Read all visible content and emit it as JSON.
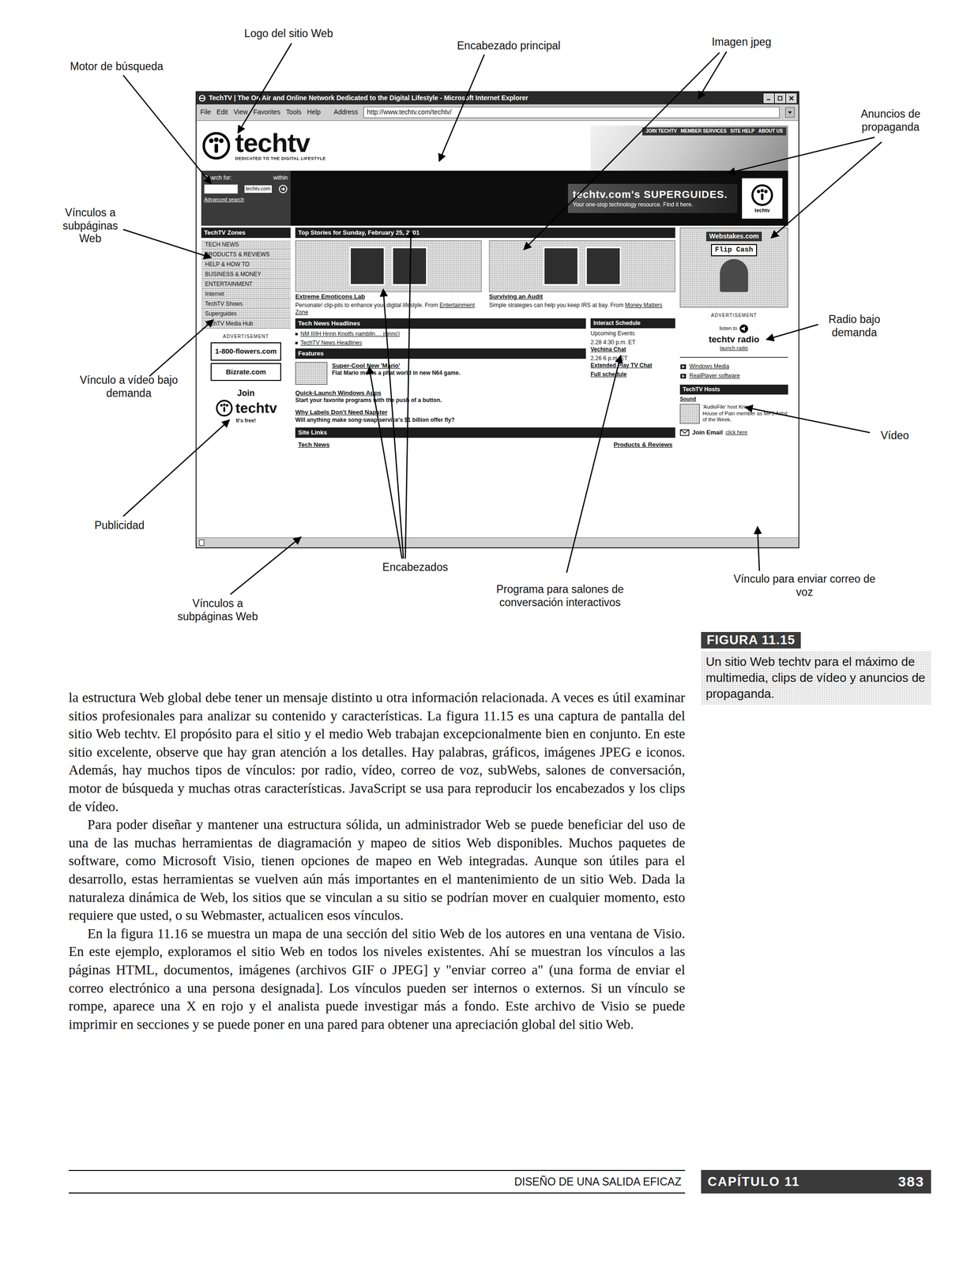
{
  "callouts": [
    {
      "label": "Logo del sitio Web"
    },
    {
      "label": "Encabezado principal"
    },
    {
      "label": "Imagen jpeg"
    },
    {
      "label": "Motor de búsqueda"
    },
    {
      "label": "Anuncios de propaganda"
    },
    {
      "label": "Vínculos a subpáginas Web"
    },
    {
      "label": "Radio bajo demanda"
    },
    {
      "label": "Vínculo a vídeo bajo demanda"
    },
    {
      "label": "Vídeo"
    },
    {
      "label": "Publicidad"
    },
    {
      "label": "Encabezados"
    },
    {
      "label": "Programa para salones de conversación interactivos"
    },
    {
      "label": "Vínculo para enviar correo de voz"
    },
    {
      "label": "Vínculos a subpáginas Web"
    }
  ],
  "browser": {
    "title": "TechTV | The On Air and Online Network Dedicated to the Digital Lifestyle - Microsoft Internet Explorer",
    "menu": [
      "File",
      "Edit",
      "View",
      "Favorites",
      "Tools",
      "Help"
    ],
    "address_label": "Address",
    "address": "http://www.techtv.com/techtv/"
  },
  "site": {
    "logo": "techtv",
    "tagline": "DEDICATED TO THE DIGITAL LIFESTYLE",
    "top_links": [
      "JOIN TECHTV",
      "MEMBER SERVICES",
      "SITE HELP",
      "ABOUT US"
    ],
    "search": {
      "label": "Search for:",
      "within": "within",
      "scope": "techtv.com",
      "advanced": "Advanced search"
    },
    "banner": {
      "title": "techtv.com's SUPERGUIDES.",
      "subtitle": "Your one-stop technology resource. Find it here.",
      "badge": "techtv"
    },
    "zones": {
      "title": "TechTV Zones",
      "items": [
        "TECH NEWS",
        "PRODUCTS & REVIEWS",
        "HELP & HOW TO",
        "BUSINESS & MONEY",
        "ENTERTAINMENT",
        "Internet",
        "TechTV Shows",
        "Superguides",
        "TechTV Media Hub"
      ]
    },
    "ads": {
      "label": "ADVERTISEMENT",
      "items": [
        "1-800-flowers.com",
        "Bizrate.com"
      ]
    },
    "join": {
      "title": "Join",
      "brand": "techtv",
      "sub": "It's free!"
    },
    "top_stories": {
      "title": "Top Stories for Sunday, February 25, 2001",
      "stories": [
        {
          "headline": "Extreme Emoticons Lab",
          "text": "Personate! clip-pils to enhance your digital lifestyle. From",
          "source": "Entertainment Zone"
        },
        {
          "headline": "Surviving an Audit",
          "text": "Simple strategies can help you keep IRS at bay. From",
          "source": "Money Matters"
        }
      ]
    },
    "headlines": {
      "title": "Tech News Headlines",
      "items": [
        "NM IIIIH Hnnn Knotfs namblln.... jsinns'i",
        "TechTV News Headlines"
      ]
    },
    "schedule": {
      "title": "Interact Schedule",
      "subtitle": "Upcoming Events",
      "events": [
        {
          "time": "2.28 4:30 p.m. ET",
          "name": "Vechina Chat"
        },
        {
          "time": "2.26 6 p.m. ET",
          "name": "Extended Play TV Chat"
        }
      ],
      "more": "Full schedule"
    },
    "features": {
      "title": "Features",
      "items": [
        {
          "headline": "Super-Cool New 'Mario'",
          "text": "Flat Mario meets a phat world in new N64 game.",
          "kind": "thumb"
        },
        {
          "headline": "Quick-Launch Windows Apps",
          "text": "Start your favorite programs with the push of a button.",
          "kind": "plain"
        },
        {
          "headline": "Why Labels Don't Need Napster",
          "text": "Will anything make song-swap service's $1 billion offer fly?",
          "kind": "plain"
        }
      ]
    },
    "links_bar": {
      "title": "Site Links",
      "items": [
        "Tech News",
        "Products & Reviews"
      ]
    },
    "right_ad": {
      "brand": "Webstakes.com",
      "button": "Flip Cash",
      "label": "ADVERTISEMENT"
    },
    "radio": {
      "pre": "listen to",
      "title": "techtv radio",
      "link": "launch radio"
    },
    "video": [
      "Windows Media",
      "RealPlayer software"
    ],
    "hosts": {
      "title": "TechTV Hosts",
      "name": "Sound",
      "lines": [
        "'AudioFile' host Kris",
        "House of Pain member as MP3 Artist of the Week."
      ]
    },
    "email": {
      "title": "Join Email",
      "link": "click here"
    }
  },
  "caption": {
    "number": "FIGURA 11.15",
    "text": "Un sitio Web techtv para el máximo de multimedia, clips de vídeo y anuncios de propaganda."
  },
  "body": [
    "la estructura Web global debe tener un mensaje distinto u otra información relacionada. A veces es útil examinar sitios profesionales para analizar su contenido y características. La figura 11.15 es una captura de pantalla del sitio Web techtv. El propósito para el sitio y el medio Web trabajan excepcionalmente bien en conjunto. En este sitio excelente, observe que hay gran atención a los detalles. Hay palabras, gráficos, imágenes JPEG e iconos. Además, hay muchos tipos de vínculos: por radio, vídeo, correo de voz, subWebs, salones de conversación, motor de búsqueda y muchas otras características. JavaScript se usa para reproducir los encabezados y los clips de vídeo.",
    "Para poder diseñar y mantener una estructura sólida, un administrador Web se puede beneficiar del uso de una de las muchas herramientas de diagramación y mapeo de sitios Web disponibles. Muchos paquetes de software, como Microsoft Visio, tienen opciones de mapeo en Web integradas. Aunque son útiles para el desarrollo, estas herramientas se vuelven aún más importantes en el mantenimiento de un sitio Web. Dada la naturaleza dinámica de Web, los sitios que se vinculan a su sitio se podrían mover en cualquier momento, esto requiere que usted, o su Webmaster, actualicen esos vínculos.",
    "En la figura 11.16 se muestra un mapa de una sección del sitio Web de los autores en una ventana de Visio. En este ejemplo, exploramos el sitio Web en todos los niveles existentes. Ahí se muestran los vínculos a las páginas HTML, documentos, imágenes (archivos GIF o JPEG] y \"enviar correo a\" (una forma de enviar el correo electrónico a una persona designada]. Los vínculos pueden ser internos o externos. Si un vínculo se rompe, aparece una X en rojo y el analista puede investigar más a fondo. Este archivo de Visio se puede imprimir en secciones y se puede poner en una pared para obtener una apreciación global del sitio Web."
  ],
  "footer": {
    "title": "DISEÑO DE UNA SALIDA EFICAZ",
    "chapter": "CAPÍTULO 11",
    "page": "383"
  }
}
